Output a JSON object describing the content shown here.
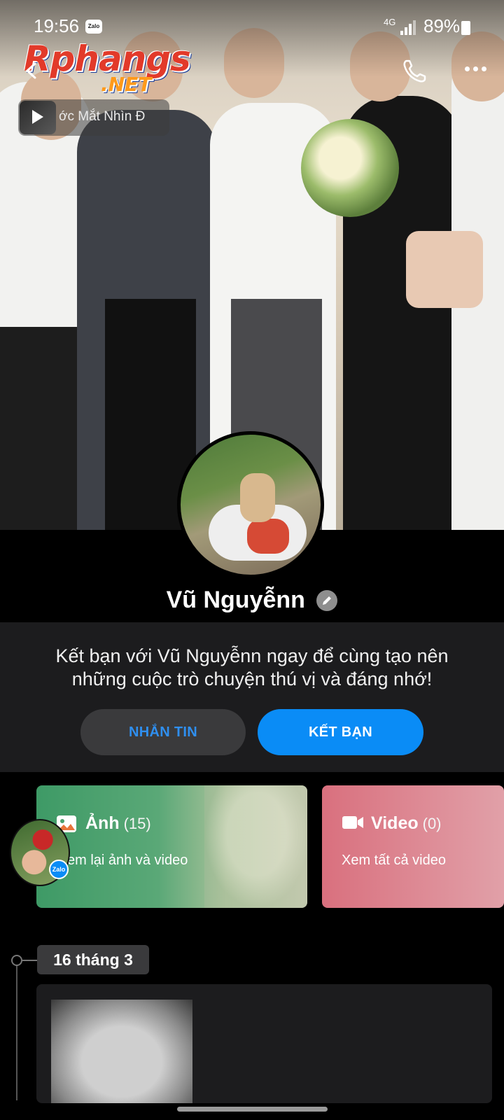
{
  "status_bar": {
    "time": "19:56",
    "notif_app": "Zalo",
    "network": "4G",
    "battery": "89%"
  },
  "watermark": {
    "brand": "Rphangs",
    "domain": ".NET"
  },
  "music": {
    "title": "ớc Mắt Nhìn Đ"
  },
  "profile": {
    "name": "Vũ Nguyễnn"
  },
  "friend_prompt": {
    "text": "Kết bạn với Vũ Nguyễnn ngay để cùng tạo nên những cuộc trò chuyện thú vị và đáng nhớ!",
    "message_button": "NHẮN TIN",
    "add_friend_button": "KẾT BẠN"
  },
  "media": {
    "photos": {
      "label": "Ảnh",
      "count": "(15)",
      "subtitle": "em lại ảnh và video"
    },
    "videos": {
      "label": "Video",
      "count": "(0)",
      "subtitle": "Xem tất cả video"
    }
  },
  "timeline": {
    "date": "16 tháng 3"
  },
  "floating_badge": "Zalo",
  "colors": {
    "accent": "#0a8cf6",
    "panel": "#1c1c1e",
    "photo_card": "#4aa06d",
    "video_card": "#d9707e"
  }
}
